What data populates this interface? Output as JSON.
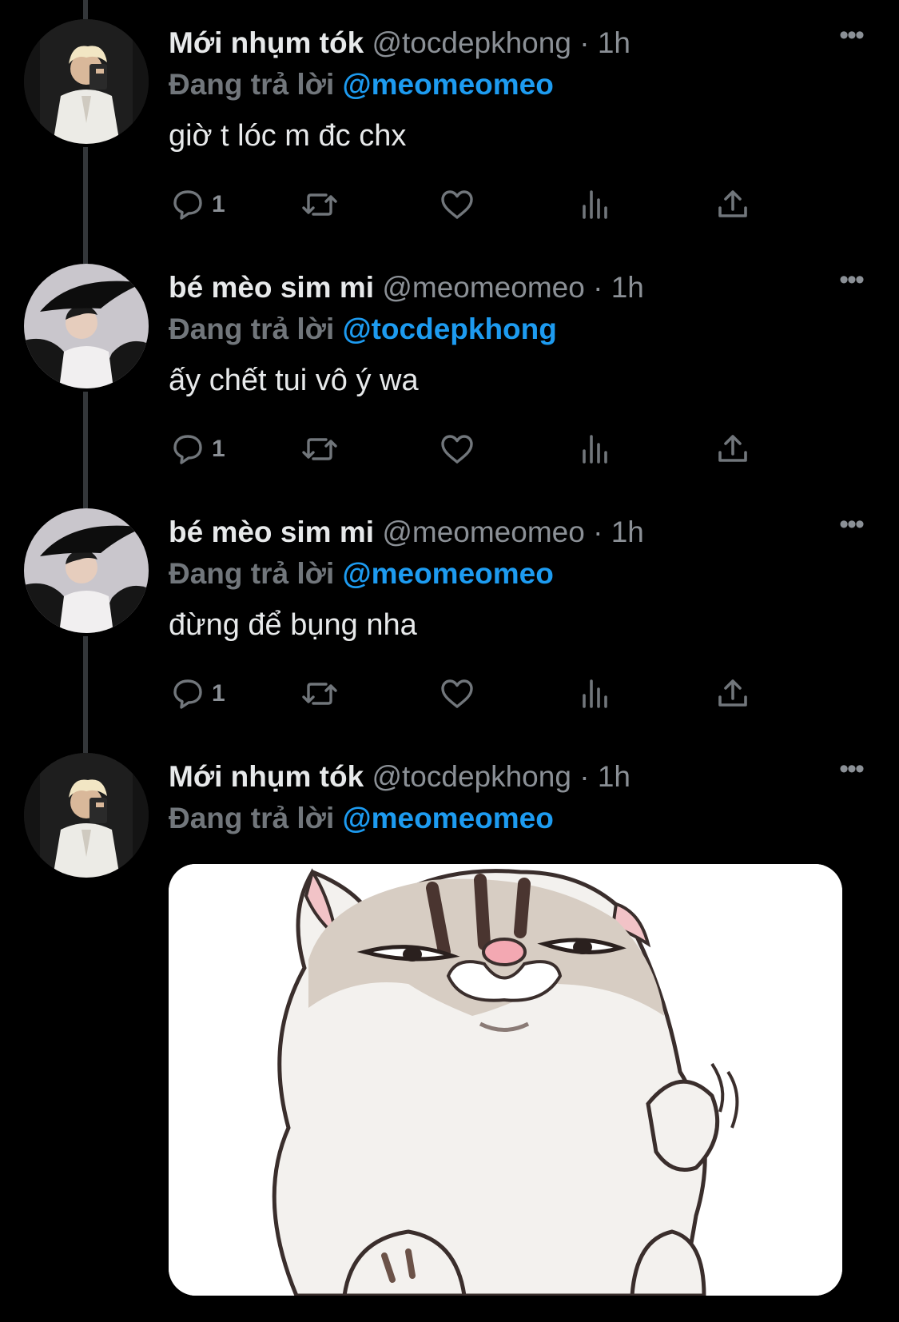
{
  "tweets": [
    {
      "author_name": "Mới nhụm tók",
      "handle": "@tocdepkhong",
      "separator": "·",
      "time": "1h",
      "replying_label": "Đang trả lời",
      "replying_to": "@meomeomeo",
      "text": "giờ t lóc m đc chx",
      "reply_count": "1",
      "avatar": "avatar-blond-white-suit"
    },
    {
      "author_name": "bé mèo sim mi",
      "handle": "@meomeomeo",
      "separator": "·",
      "time": "1h",
      "replying_label": "Đang trả lời",
      "replying_to": "@tocdepkhong",
      "text": "ấy chết tui vô ý wa",
      "reply_count": "1",
      "avatar": "avatar-black-hat"
    },
    {
      "author_name": "bé mèo sim mi",
      "handle": "@meomeomeo",
      "separator": "·",
      "time": "1h",
      "replying_label": "Đang trả lời",
      "replying_to": "@meomeomeo",
      "text": "đừng để bụng nha",
      "reply_count": "1",
      "avatar": "avatar-black-hat"
    },
    {
      "author_name": "Mới nhụm tók",
      "handle": "@tocdepkhong",
      "separator": "·",
      "time": "1h",
      "replying_label": "Đang trả lời",
      "replying_to": "@meomeomeo",
      "media": "cat-sticker-image",
      "avatar": "avatar-blond-white-suit"
    }
  ],
  "icons": {
    "reply": "reply-icon",
    "retweet": "retweet-icon",
    "like": "heart-icon",
    "views": "views-icon",
    "share": "share-icon",
    "more": "more-icon"
  },
  "colors": {
    "background": "#000000",
    "text": "#e7e9ea",
    "muted": "#71767b",
    "mention": "#1d9bf0",
    "thread_line": "#333639"
  }
}
